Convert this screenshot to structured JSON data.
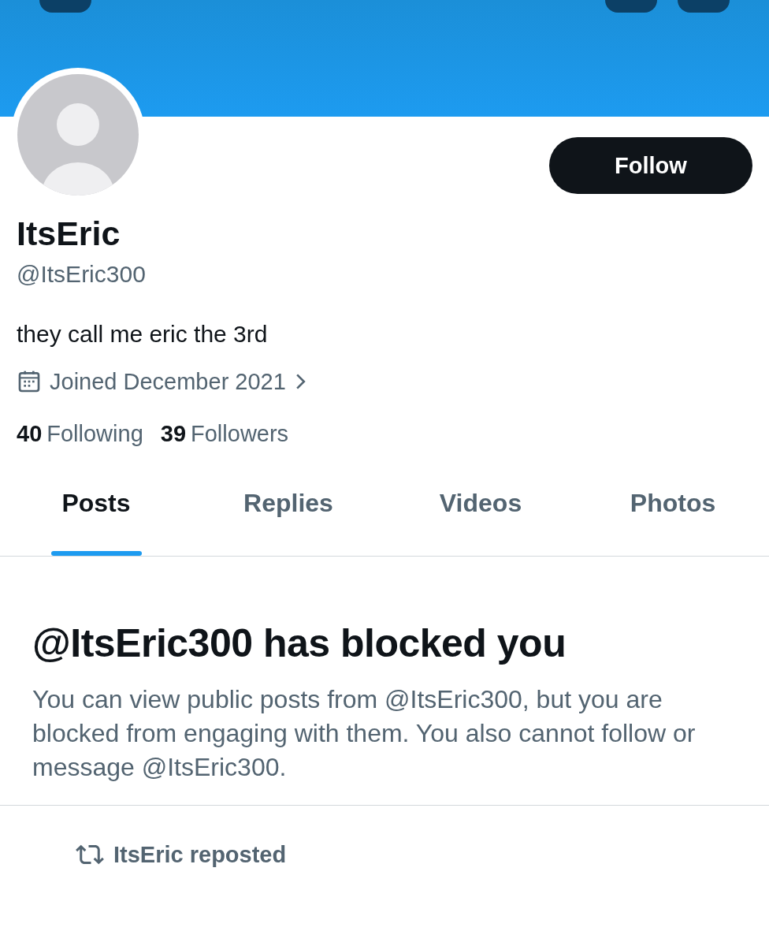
{
  "profile": {
    "name": "ItsEric",
    "handle": "@ItsEric300",
    "bio": "they call me eric the 3rd",
    "joined": "Joined December 2021",
    "stats": [
      {
        "count": "40",
        "label": "Following"
      },
      {
        "count": "39",
        "label": "Followers"
      }
    ]
  },
  "follow_button": "Follow",
  "tabs": [
    {
      "label": "Posts",
      "selected": true
    },
    {
      "label": "Replies",
      "selected": false
    },
    {
      "label": "Videos",
      "selected": false
    },
    {
      "label": "Photos",
      "selected": false
    }
  ],
  "blocked": {
    "title": "@ItsEric300 has blocked you",
    "message": "You can view public posts from @ItsEric300, but you are blocked from engaging with them. You also cannot follow or message @ItsEric300."
  },
  "feed": [
    {
      "repost_label": "ItsEric reposted"
    }
  ]
}
